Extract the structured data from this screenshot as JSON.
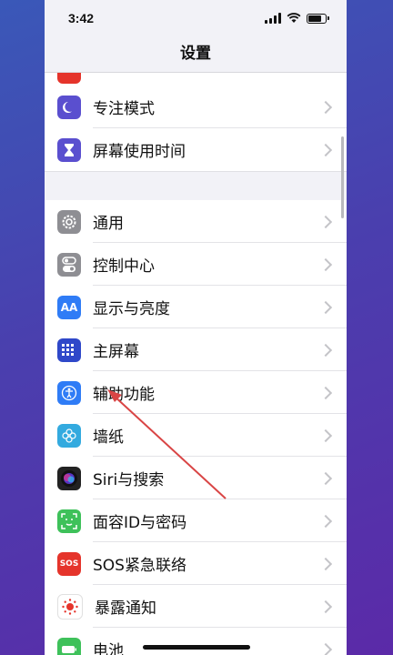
{
  "status": {
    "time": "3:42"
  },
  "nav": {
    "title": "设置"
  },
  "group_top": [
    {
      "label": "专注模式",
      "icon": "moon-icon",
      "color": "#5a4fcf"
    },
    {
      "label": "屏幕使用时间",
      "icon": "hourglass-icon",
      "color": "#5a4fcf"
    }
  ],
  "group_main": [
    {
      "label": "通用",
      "icon": "gear-icon",
      "color": "#8e8e93"
    },
    {
      "label": "控制中心",
      "icon": "toggle-icon",
      "color": "#8e8e93"
    },
    {
      "label": "显示与亮度",
      "icon": "text-size-icon",
      "color": "#2f7cf6",
      "glyph": "AA"
    },
    {
      "label": "主屏幕",
      "icon": "grid-icon",
      "color": "#2f48c9"
    },
    {
      "label": "辅助功能",
      "icon": "accessibility-icon",
      "color": "#2f7cf6"
    },
    {
      "label": "墙纸",
      "icon": "flower-icon",
      "color": "#33aadf"
    },
    {
      "label": "Siri与搜索",
      "icon": "siri-icon",
      "color": "#222222"
    },
    {
      "label": "面容ID与密码",
      "icon": "face-id-icon",
      "color": "#3ec15a"
    },
    {
      "label": "SOS紧急联络",
      "icon": "sos-icon",
      "color": "#e5342b",
      "glyph": "SOS"
    },
    {
      "label": "暴露通知",
      "icon": "exposure-icon",
      "color": "#ffffff"
    },
    {
      "label": "电池",
      "icon": "battery-icon",
      "color": "#3ec15a"
    }
  ],
  "colors": {
    "arrow": "#d94545"
  }
}
